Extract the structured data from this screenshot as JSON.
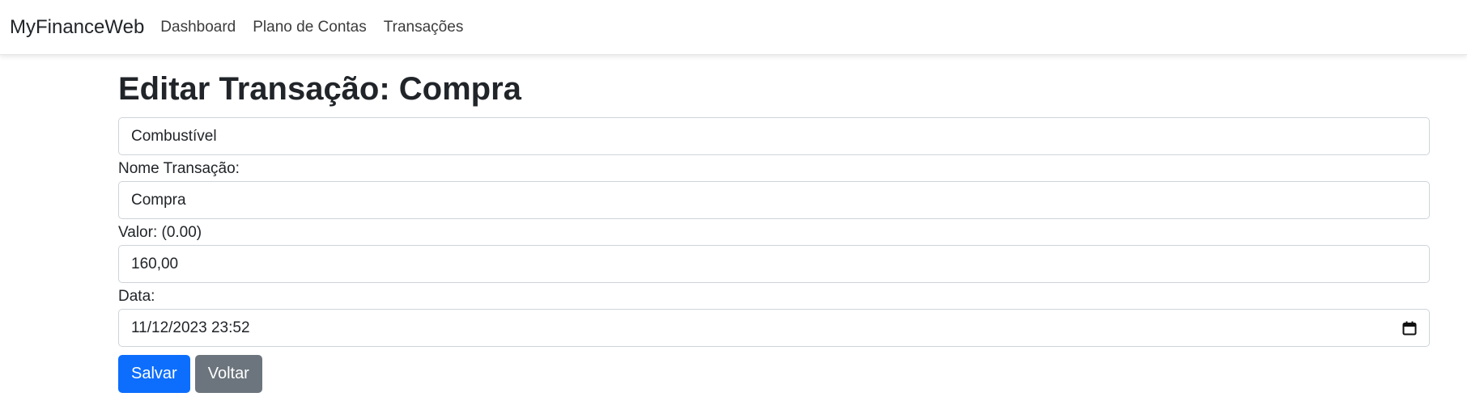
{
  "navbar": {
    "brand": "MyFinanceWeb",
    "links": [
      "Dashboard",
      "Plano de Contas",
      "Transações"
    ]
  },
  "page": {
    "title": "Editar Transação: Compra"
  },
  "form": {
    "conta": "Combustível",
    "nome_label": "Nome Transação:",
    "nome_value": "Compra",
    "valor_label": "Valor: (0.00)",
    "valor_value": "160,00",
    "data_label": "Data:",
    "data_value": "11/12/2023 23:52",
    "save_label": "Salvar",
    "back_label": "Voltar"
  },
  "colors": {
    "primary": "#0d6efd",
    "secondary": "#6c757d"
  },
  "icons": {
    "date": "calendar-icon"
  }
}
